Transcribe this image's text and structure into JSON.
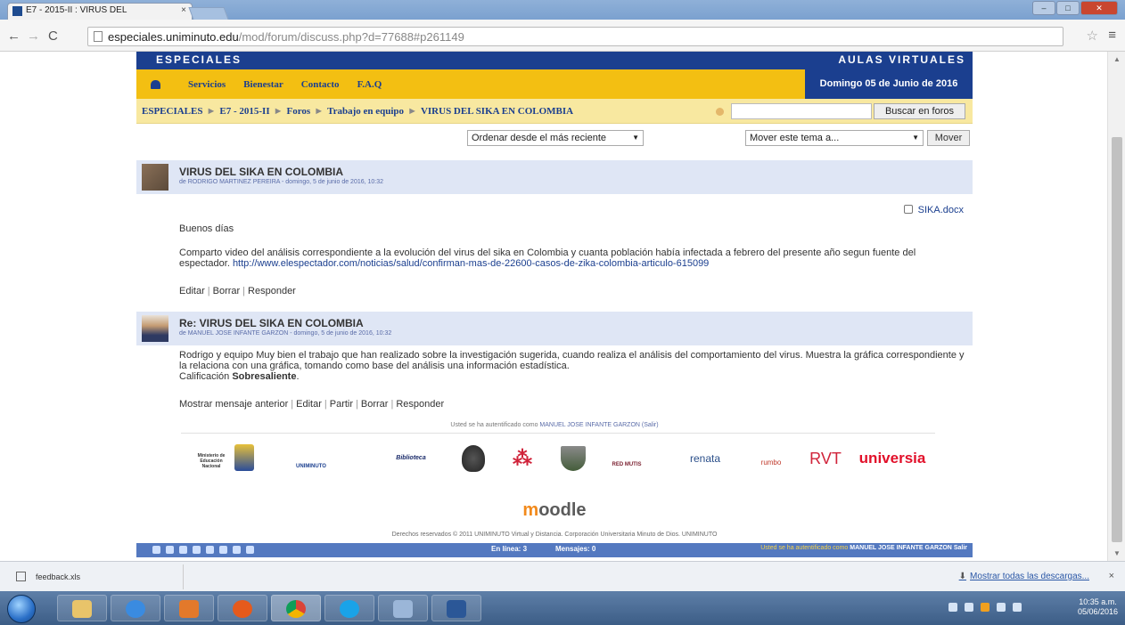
{
  "browser": {
    "tab_title": "E7 - 2015-II : VIRUS DEL",
    "tab_close": "×",
    "url_host": "especiales.uniminuto.edu",
    "url_path": "/mod/forum/discuss.php?d=77688#p261149"
  },
  "site": {
    "top_left": "ESPECIALES",
    "top_right": "AULAS VIRTUALES",
    "nav": [
      "Servicios",
      "Bienestar",
      "Contacto",
      "F.A.Q"
    ],
    "date": "Domingo 05 de Junio de 2016"
  },
  "breadcrumb": [
    "ESPECIALES",
    "E7 - 2015-II",
    "Foros",
    "Trabajo en equipo",
    "VIRUS DEL SIKA EN COLOMBIA"
  ],
  "breadcrumb_sep": "►",
  "search_button": "Buscar en foros",
  "controls": {
    "sort_select": "Ordenar desde el más reciente",
    "move_select": "Mover este tema a...",
    "move_button": "Mover"
  },
  "posts": [
    {
      "title": "VIRUS DEL SIKA EN COLOMBIA",
      "author_line": "de RODRIGO MARTINEZ PEREIRA - domingo, 5 de junio de 2016, 10:32",
      "attachment": "SIKA.docx",
      "greeting": "Buenos días",
      "body": "Comparto video del análisis correspondiente a la evolución del virus del sika en Colombia y cuanta población había infectada a febrero del presente año segun fuente del espectador.",
      "link": "http://www.elespectador.com/noticias/salud/confirman-mas-de-22600-casos-de-zika-colombia-articulo-615099",
      "commands": [
        "Editar",
        "Borrar",
        "Responder"
      ]
    },
    {
      "title": "Re: VIRUS DEL SIKA EN COLOMBIA",
      "author_line": "de MANUEL JOSE INFANTE GARZON - domingo, 5 de junio de 2016, 10:32",
      "body": "Rodrigo y equipo Muy bien el trabajo que han realizado sobre la investigación sugerida, cuando realiza el análisis del comportamiento del virus. Muestra la gráfica correspondiente y la relaciona con una gráfica, tomando como base del análisis una información estadística.",
      "grade_label": "Calificación",
      "grade_value": "Sobresaliente",
      "commands": [
        "Mostrar mensaje anterior",
        "Editar",
        "Partir",
        "Borrar",
        "Responder"
      ]
    }
  ],
  "logged_in_prefix": "Usted se ha autentificado como",
  "logged_in_user": "MANUEL JOSE INFANTE GARZON",
  "logged_in_logout": "(Salir)",
  "logos": [
    "Ministerio de Educación Nacional",
    "UNIMINUTO",
    "Biblioteca",
    "RED MUTIS",
    "renata",
    "rumbo",
    "RVT",
    "universia"
  ],
  "moodle": {
    "m": "m",
    "rest": "oodle"
  },
  "copyright": "Derechos reservados © 2011 UNIMINUTO Virtual y Distancia. Corporación Universitaria Minuto de Dios. UNIMINUTO",
  "bottom_bar": {
    "online": "En línea: 3",
    "messages": "Mensajes: 0",
    "user_prefix": "Usted se ha autentificado como",
    "user": "MANUEL JOSE INFANTE GARZON",
    "logout": "Salir"
  },
  "downloads": {
    "file": "feedback.xls",
    "show_all": "Mostrar todas las descargas...",
    "close": "×"
  },
  "taskbar": {
    "time": "10:35 a.m.",
    "date": "05/06/2016"
  }
}
